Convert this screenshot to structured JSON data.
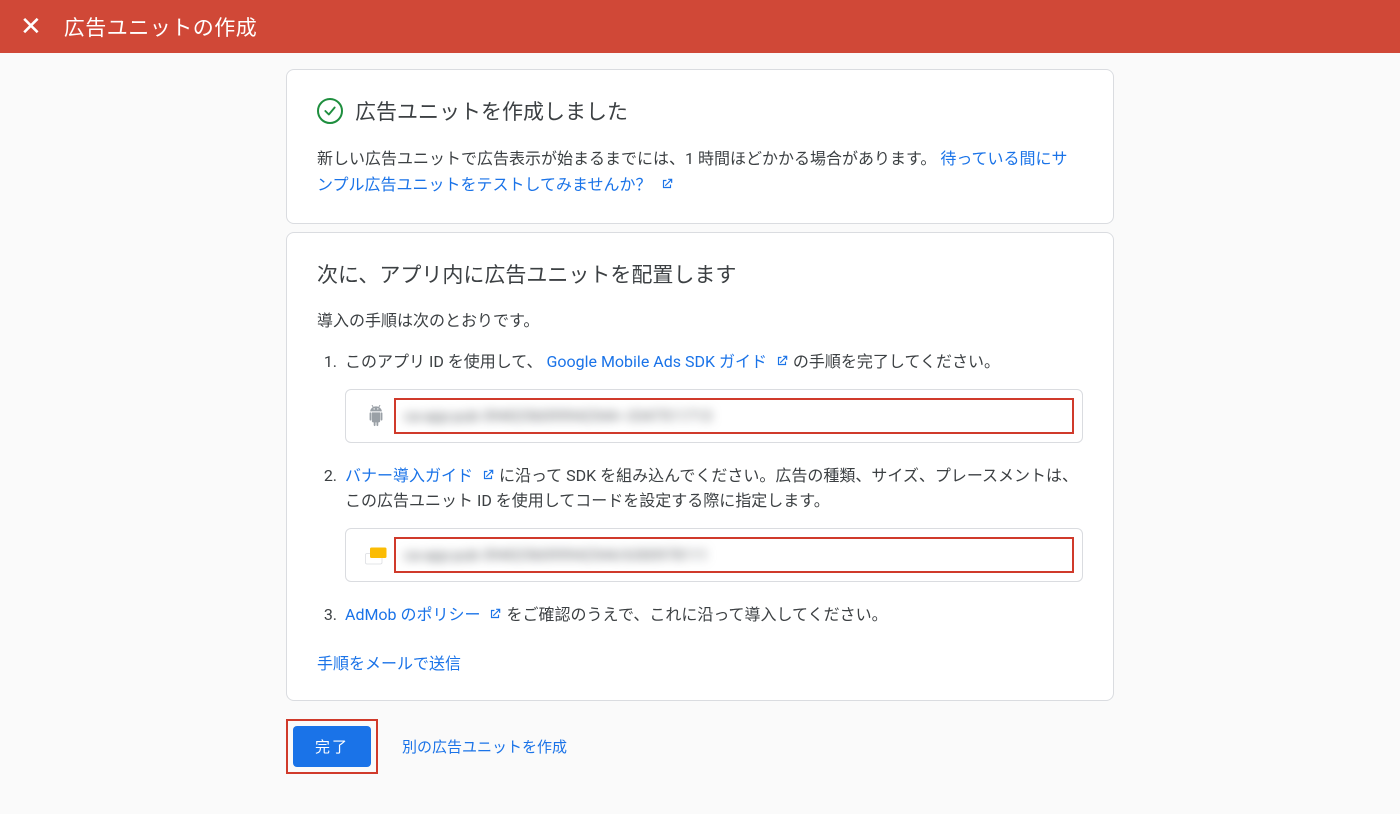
{
  "header": {
    "title": "広告ユニットの作成"
  },
  "success": {
    "title": "広告ユニットを作成しました",
    "body_prefix": "新しい広告ユニットで広告表示が始まるまでには、1 時間ほどかかる場合があります。 ",
    "test_link": "待っている間にサンプル広告ユニットをテストしてみませんか？"
  },
  "steps": {
    "title": "次に、アプリ内に広告ユニットを配置します",
    "intro": "導入の手順は次のとおりです。",
    "item1_prefix": "このアプリ ID を使用して、",
    "item1_link": "Google Mobile Ads SDK ガイド",
    "item1_suffix": "の手順を完了してください。",
    "app_id": "ca-app-pub-3940256099942544~3347511713",
    "item2_link": "バナー導入ガイド",
    "item2_suffix": "に沿って SDK を組み込んでください。広告の種類、サイズ、プレースメントは、この広告ユニット ID を使用してコードを設定する際に指定します。",
    "ad_unit_id": "ca-app-pub-3940256099942544/6300978111",
    "item3_link": "AdMob のポリシー",
    "item3_suffix": "をご確認のうえで、これに沿って導入してください。",
    "mail_link": "手順をメールで送信"
  },
  "actions": {
    "done": "完了",
    "another": "別の広告ユニットを作成"
  }
}
